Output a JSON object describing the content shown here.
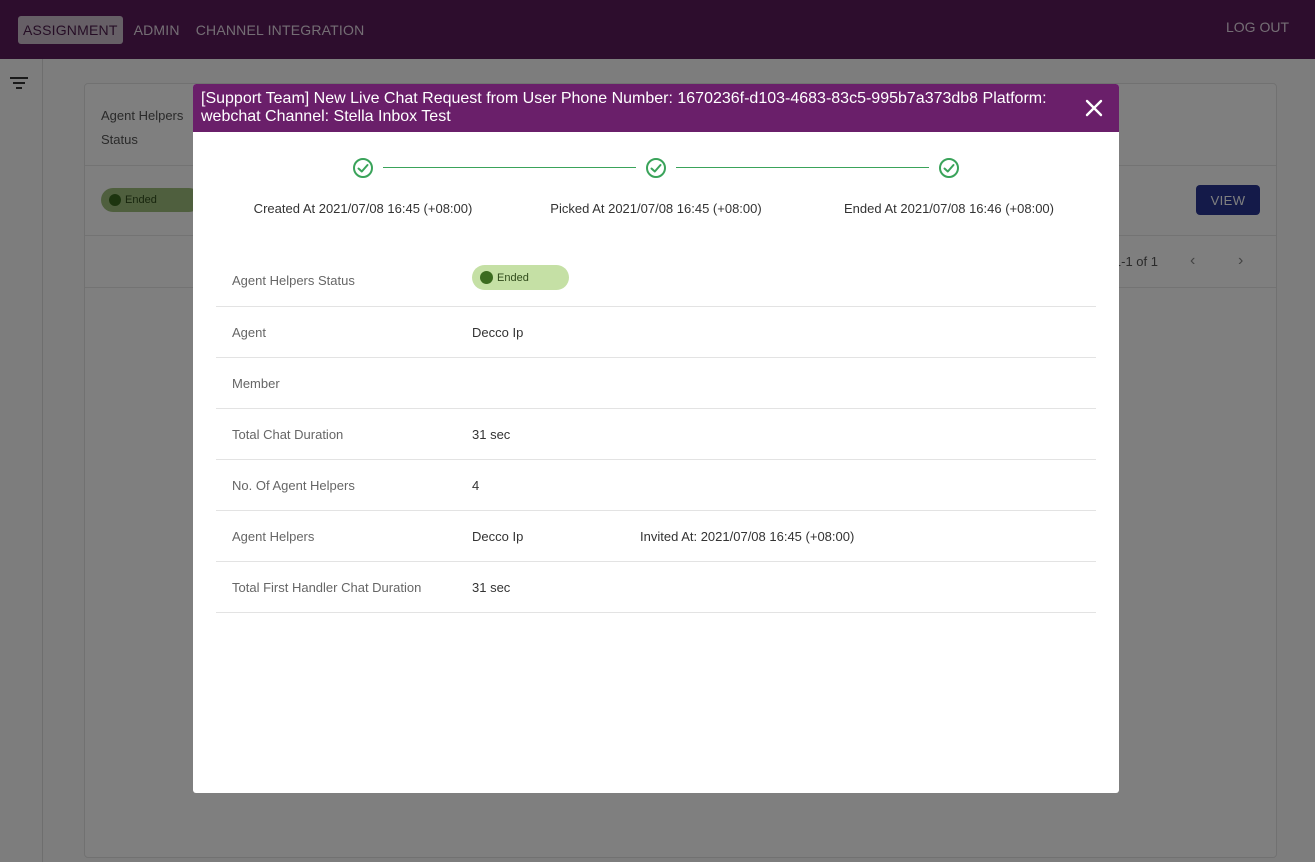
{
  "nav": {
    "items": [
      {
        "label": "ASSIGNMENT",
        "active": true
      },
      {
        "label": "ADMIN",
        "active": false
      },
      {
        "label": "CHANNEL INTEGRATION",
        "active": false
      }
    ],
    "logout_label": "LOG OUT"
  },
  "background": {
    "column_label": "Agent Helpers Status",
    "chip_label": "Ended",
    "view_label": "VIEW",
    "pager_text": "1-1 of 1"
  },
  "modal": {
    "title": "[Support Team] New Live Chat Request from User Phone Number: 1670236f-d103-4683-83c5-995b7a373db8 Platform: webchat Channel: Stella Inbox Test",
    "steps": [
      {
        "label": "Created At 2021/07/08 16:45 (+08:00)"
      },
      {
        "label": "Picked At 2021/07/08 16:45 (+08:00)"
      },
      {
        "label": "Ended At 2021/07/08 16:46 (+08:00)"
      }
    ],
    "details": {
      "status_label": "Agent Helpers Status",
      "status_value": "Ended",
      "agent_label": "Agent",
      "agent_value": "Decco Ip",
      "member_label": "Member",
      "member_value": "",
      "duration_label": "Total Chat Duration",
      "duration_value": "31 sec",
      "helpers_count_label": "No. Of Agent Helpers",
      "helpers_count_value": "4",
      "helpers_label": "Agent Helpers",
      "helpers_value": "Decco Ip",
      "helpers_invited": "Invited At: 2021/07/08 16:45 (+08:00)",
      "first_handler_label": "Total First Handler Chat Duration",
      "first_handler_value": "31 sec"
    }
  },
  "colors": {
    "topbar": "#5a1a5a",
    "modal_header": "#6a1f6a",
    "step_green": "#3aa35a",
    "chip_bg": "#c5e0a5",
    "view_button": "#283593"
  },
  "icons": {
    "filter": "filter-icon",
    "close": "close-icon",
    "step": "check-circle-icon",
    "prev": "chevron-left-icon",
    "next": "chevron-right-icon"
  }
}
